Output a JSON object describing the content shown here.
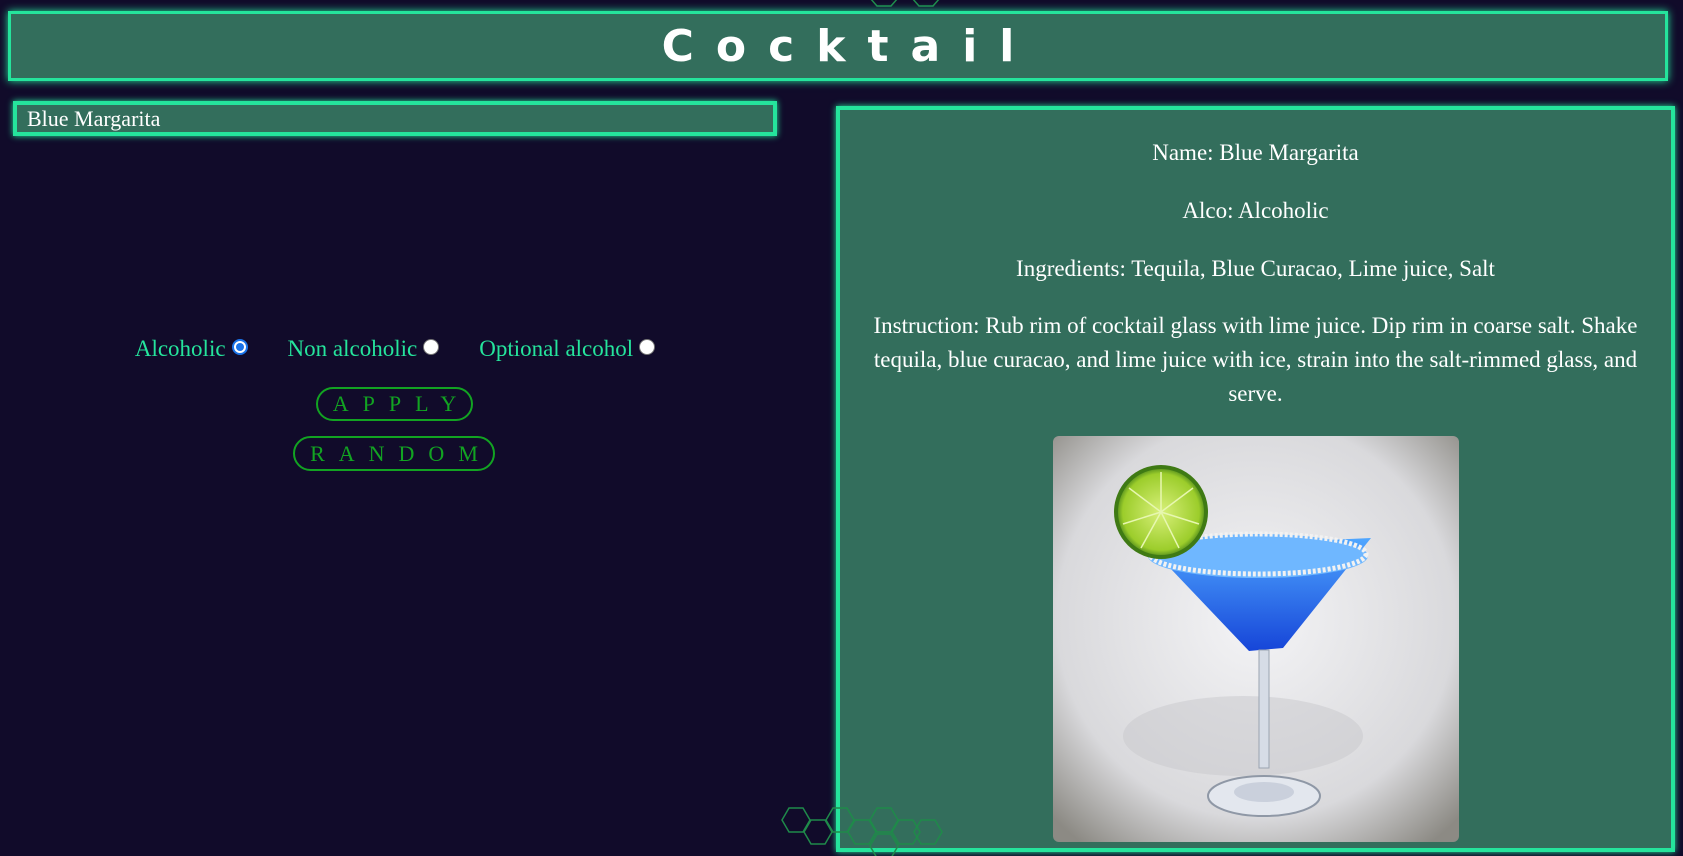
{
  "header": {
    "title": "Cocktail"
  },
  "search": {
    "value": "Blue Margarita"
  },
  "filters": {
    "options": [
      {
        "label": "Alcoholic",
        "checked": true
      },
      {
        "label": "Non alcoholic",
        "checked": false
      },
      {
        "label": "Optional alcohol",
        "checked": false
      }
    ]
  },
  "buttons": {
    "apply_label": "APPLY",
    "random_label": "RANDOM"
  },
  "details": {
    "name": "Name: Blue Margarita",
    "alco": "Alco: Alcoholic",
    "ingredients": "Ingredients: Tequila, Blue Curacao, Lime juice, Salt",
    "instruction": "Instruction: Rub rim of cocktail glass with lime juice. Dip rim in coarse salt. Shake tequila, blue curacao, and lime juice with ice, strain into the salt-rimmed glass, and serve."
  },
  "colors": {
    "background": "#110b2a",
    "panel": "#336e5c",
    "accent": "#25e49c",
    "button": "#12a322",
    "drink": "#1a5fe0"
  }
}
